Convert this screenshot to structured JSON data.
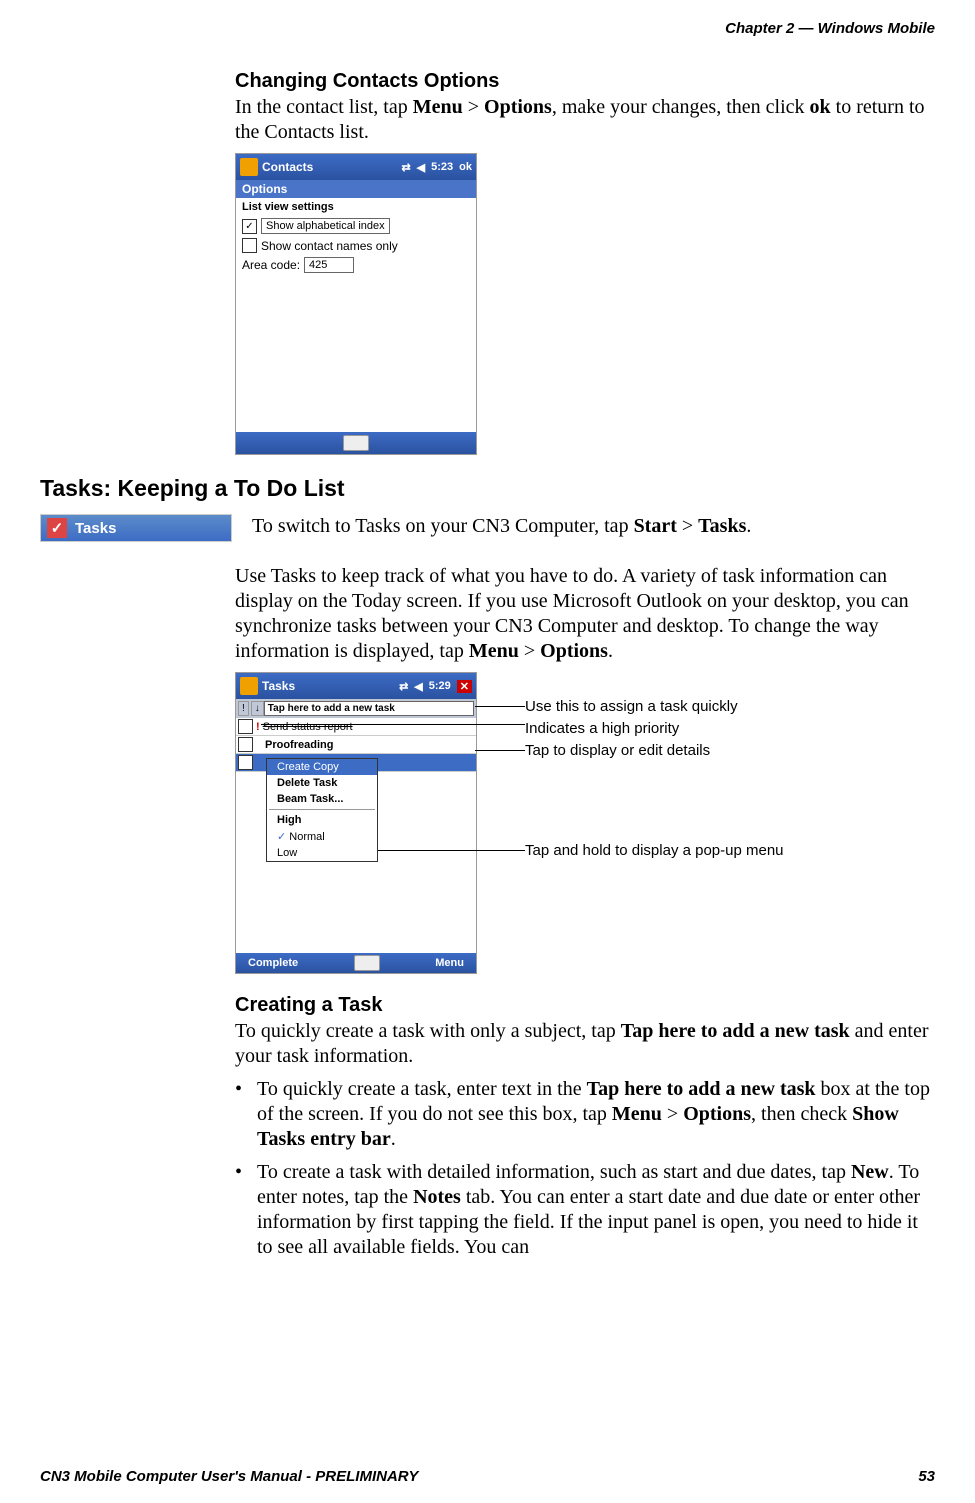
{
  "header": {
    "chapter": "Chapter 2 —  Windows Mobile"
  },
  "section1": {
    "heading": "Changing Contacts Options",
    "text_parts": [
      "In the contact list, tap ",
      "Menu",
      " > ",
      "Options",
      ", make your changes, then click ",
      "ok",
      " to return to the Contacts list."
    ]
  },
  "screenshot1": {
    "title": "Contacts",
    "time": "5:23",
    "ok": "ok",
    "subbar": "Options",
    "section_label": "List view settings",
    "check1_label": "Show alphabetical index",
    "check1_checked": true,
    "check2_label": "Show contact names only",
    "check2_checked": false,
    "area_code_label": "Area code:",
    "area_code_value": "425"
  },
  "section2": {
    "heading": "Tasks: Keeping a To Do List",
    "tasks_label": "Tasks",
    "intro_parts": [
      "To switch to Tasks on your CN3 Computer, tap ",
      "Start",
      " > ",
      "Tasks",
      "."
    ],
    "para_parts": [
      "Use Tasks to keep track of what you have to do. A variety of task information can display on the Today screen. If you use Microsoft Outlook on your desktop, you can synchronize tasks between your CN3 Computer and desktop. To change the way information is displayed, tap ",
      "Menu",
      " > ",
      "Options",
      "."
    ]
  },
  "screenshot2": {
    "title": "Tasks",
    "time": "5:29",
    "entry_placeholder": "Tap here to add a new task",
    "sort_col": "!",
    "task1": "Send status report",
    "task2": "Proofreading",
    "menu": {
      "item1": "Create Copy",
      "item2": "Delete Task",
      "item3": "Beam Task...",
      "item4": "High",
      "item5": "Normal",
      "item6": "Low"
    },
    "softkey_left": "Complete",
    "softkey_right": "Menu"
  },
  "annotations": {
    "a1": "Use this to assign a task quickly",
    "a2": "Indicates a high priority",
    "a3": "Tap to display or edit details",
    "a4": "Tap and hold to display a pop-up menu"
  },
  "section3": {
    "heading": "Creating a Task",
    "intro_parts": [
      "To quickly create a task with only a subject, tap ",
      "Tap here to add a new task",
      " and enter your task information."
    ],
    "bullet1_parts": [
      "To quickly create a task, enter text in the ",
      "Tap here to add a new task",
      " box at the top of the screen. If you do not see this box, tap ",
      "Menu",
      " > ",
      "Options",
      ", then check ",
      "Show Tasks entry bar",
      "."
    ],
    "bullet2_parts": [
      "To create a task with detailed information, such as start and due dates, tap ",
      "New",
      ". To enter notes, tap the ",
      "Notes",
      " tab. You can enter a start date and due date or enter other information by first tapping the field. If the input panel is open, you need to hide it to see all available fields. You can"
    ]
  },
  "footer": {
    "left": "CN3 Mobile Computer User's Manual - PRELIMINARY",
    "right": "53"
  }
}
